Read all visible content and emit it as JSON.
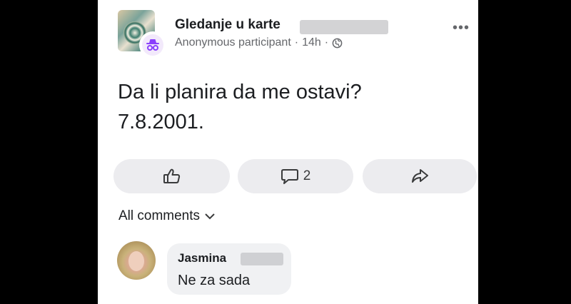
{
  "post": {
    "group_name": "Gledanje u karte",
    "author": "Anonymous participant",
    "separator": "·",
    "time": "14h",
    "text_line1": "Da li planira da me ostavi?",
    "text_line2": "7.8.2001."
  },
  "actions": {
    "comment_count": "2"
  },
  "comments": {
    "filter_label": "All comments",
    "items": [
      {
        "name": "Jasmina",
        "text": "Ne za sada"
      }
    ]
  },
  "icons": {
    "more": "more-options-icon",
    "globe": "globe-icon",
    "like": "thumbs-up-icon",
    "comment": "comment-icon",
    "share": "share-icon",
    "chevron": "chevron-down-icon",
    "anonymous": "incognito-icon"
  },
  "colors": {
    "accent_purple": "#8a3ffc",
    "text_primary": "#1c1e21",
    "text_secondary": "#65676b"
  }
}
